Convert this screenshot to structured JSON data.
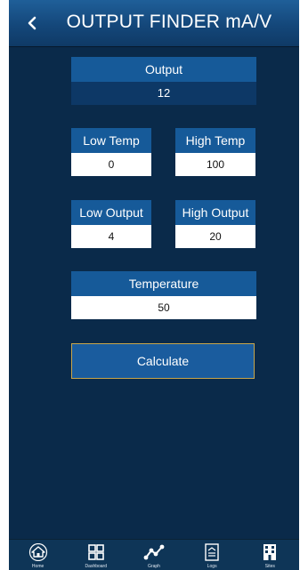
{
  "header": {
    "title": "OUTPUT FINDER mA/V",
    "back_icon": "chevron-left-icon"
  },
  "output": {
    "label": "Output",
    "value": "12"
  },
  "low_temp": {
    "label": "Low Temp",
    "value": "0"
  },
  "high_temp": {
    "label": "High Temp",
    "value": "100"
  },
  "low_output": {
    "label": "Low Output",
    "value": "4"
  },
  "high_output": {
    "label": "High Output",
    "value": "20"
  },
  "temperature": {
    "label": "Temperature",
    "value": "50"
  },
  "calculate": {
    "label": "Calculate"
  },
  "nav": {
    "items": [
      {
        "label": "Home",
        "icon": "home-icon"
      },
      {
        "label": "Dashboard",
        "icon": "dashboard-icon"
      },
      {
        "label": "Graph",
        "icon": "graph-icon"
      },
      {
        "label": "Logs",
        "icon": "logs-icon"
      },
      {
        "label": "Sites",
        "icon": "sites-icon"
      }
    ]
  },
  "colors": {
    "background": "#0a2a4a",
    "header": "#14477a",
    "label_bar": "#165a99",
    "button_border": "#c9a64a"
  }
}
